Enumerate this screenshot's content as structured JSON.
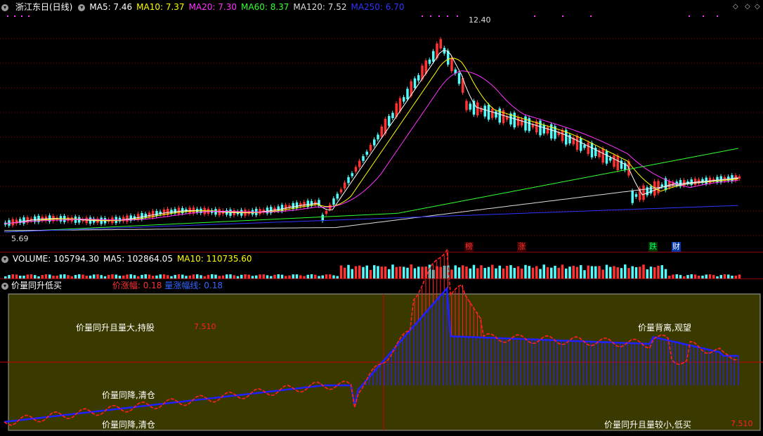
{
  "header": {
    "title": "浙江东日(日线)",
    "indicators": [
      {
        "label": "MA5: 7.46",
        "color": "#ffffff"
      },
      {
        "label": "MA10: 7.37",
        "color": "#ffff00"
      },
      {
        "label": "MA20: 7.30",
        "color": "#ff33ff"
      },
      {
        "label": "MA60: 8.37",
        "color": "#33ff33"
      },
      {
        "label": "MA120: 7.52",
        "color": "#dddddd"
      },
      {
        "label": "MA250: 6.70",
        "color": "#3333ff"
      }
    ]
  },
  "price": {
    "high_label": "12.40",
    "low_label": "5.69"
  },
  "event_tags": [
    {
      "text": "榜",
      "color": "#ff3030",
      "bg": "#3a0000"
    },
    {
      "text": "涨",
      "color": "#ff3030",
      "bg": "#3a0000"
    },
    {
      "text": "跌",
      "color": "#00ff66",
      "bg": "#003300"
    },
    {
      "text": "财",
      "color": "#ffffff",
      "bg": "#0033aa"
    }
  ],
  "volume": {
    "items": [
      {
        "label": "VOLUME: 105794.30",
        "color": "#ffffff"
      },
      {
        "label": "MA5: 102864.05",
        "color": "#ffffff"
      },
      {
        "label": "MA10: 110735.60",
        "color": "#ffff00"
      }
    ]
  },
  "indicator_panel": {
    "name": "价量同升低买",
    "items": [
      {
        "label": "价涨幅: 0.18",
        "color": "#ff3030"
      },
      {
        "label": "量涨幅线: 0.18",
        "color": "#3366ff"
      }
    ],
    "labels": {
      "hold": "价量同升且量大,持股",
      "watch": "价量背离,观望",
      "clear_mid": "价量同降,清仓",
      "clear_bottom": "价量同降,清仓",
      "buy": "价量同升且量较小,低买"
    },
    "value_left": "7.510",
    "value_right": "7.510"
  },
  "colors": {
    "up": "#54fcfc",
    "down": "#ff3232",
    "grid": "#8b0000",
    "panel_bg": "#3a3a00",
    "price_line": "#ff2020",
    "volume_line": "#2020ff"
  }
}
